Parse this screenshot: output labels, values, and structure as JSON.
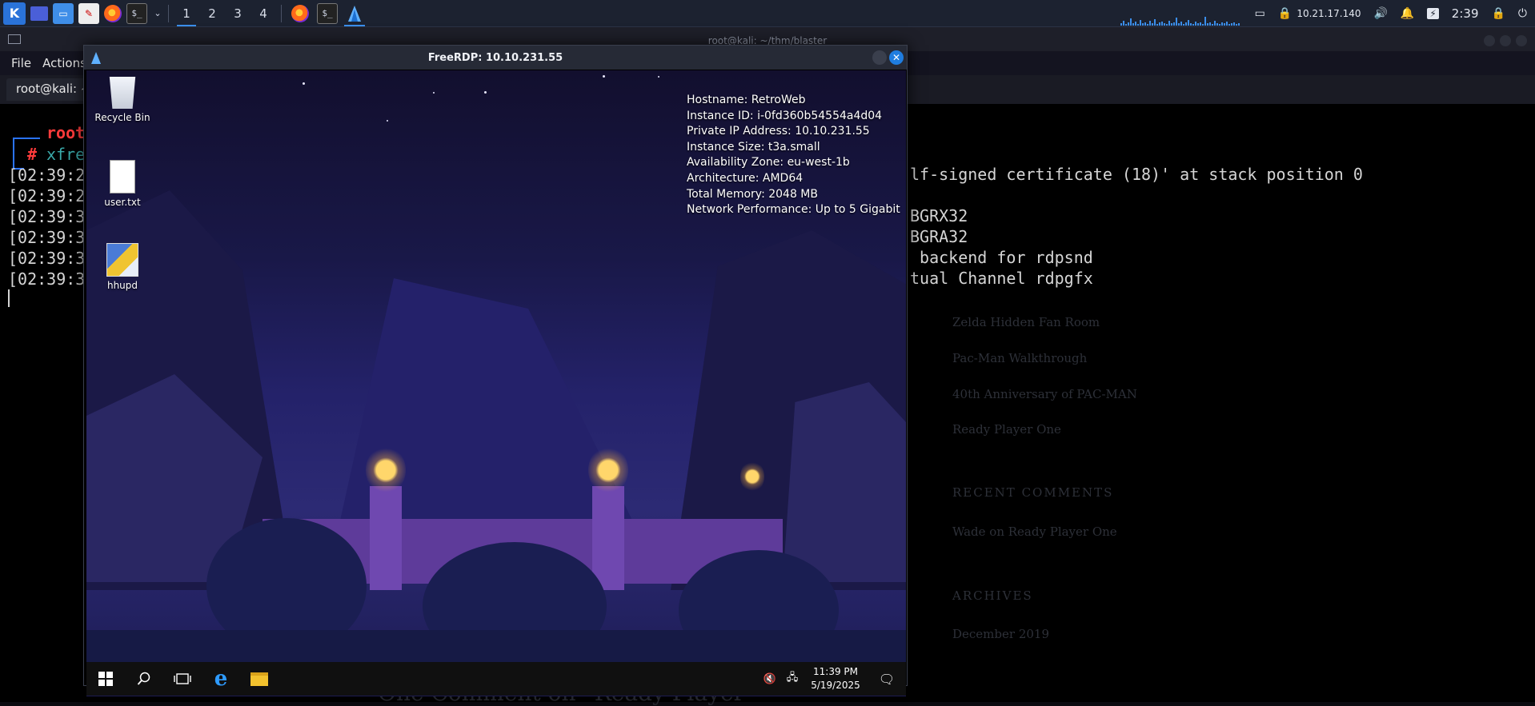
{
  "panel": {
    "workspaces": [
      "1",
      "2",
      "3",
      "4"
    ],
    "active_workspace": "1",
    "ip": "10.21.17.140",
    "time": "2:39"
  },
  "terminal": {
    "title": "root@kali: ~/thm/blaster",
    "menu": [
      "File",
      "Actions"
    ],
    "tab_label": "root@kali: ~",
    "prompt_user": "root",
    "command": "xfre",
    "log_timestamps": [
      "[02:39:2",
      "[02:39:2",
      "[02:39:3",
      "[02:39:3",
      "[02:39:3",
      "[02:39:3"
    ],
    "log_tails": [
      "lf-signed certificate (18)' at stack position 0",
      "BGRX32",
      "BGRA32",
      " backend for rdpsnd",
      "tual Channel rdpgfx"
    ],
    "ghost_text": {
      "links": [
        "Zelda Hidden Fan Room",
        "Pac-Man Walkthrough",
        "40th Anniversary of PAC-MAN",
        "Ready Player One"
      ],
      "recent_comments_heading": "RECENT COMMENTS",
      "comment": "Wade on Ready Player One",
      "archives_heading": "ARCHIVES",
      "archive": "December 2019",
      "bottom": "One Comment on “Ready Player"
    }
  },
  "rdp": {
    "title": "FreeRDP: 10.10.231.55",
    "desktop_icons": [
      "Recycle Bin",
      "user.txt",
      "hhupd"
    ],
    "info": [
      "Hostname: RetroWeb",
      "Instance ID: i-0fd360b54554a4d04",
      "Private IP Address: 10.10.231.55",
      "Instance Size: t3a.small",
      "Availability Zone: eu-west-1b",
      "Architecture: AMD64",
      "Total Memory: 2048 MB",
      "Network Performance: Up to 5 Gigabit"
    ],
    "taskbar": {
      "time": "11:39 PM",
      "date": "5/19/2025"
    }
  },
  "colors": {
    "kali_blue": "#2a73d9",
    "prompt_red": "#ff3b3b",
    "close_blue": "#1f7de0"
  }
}
